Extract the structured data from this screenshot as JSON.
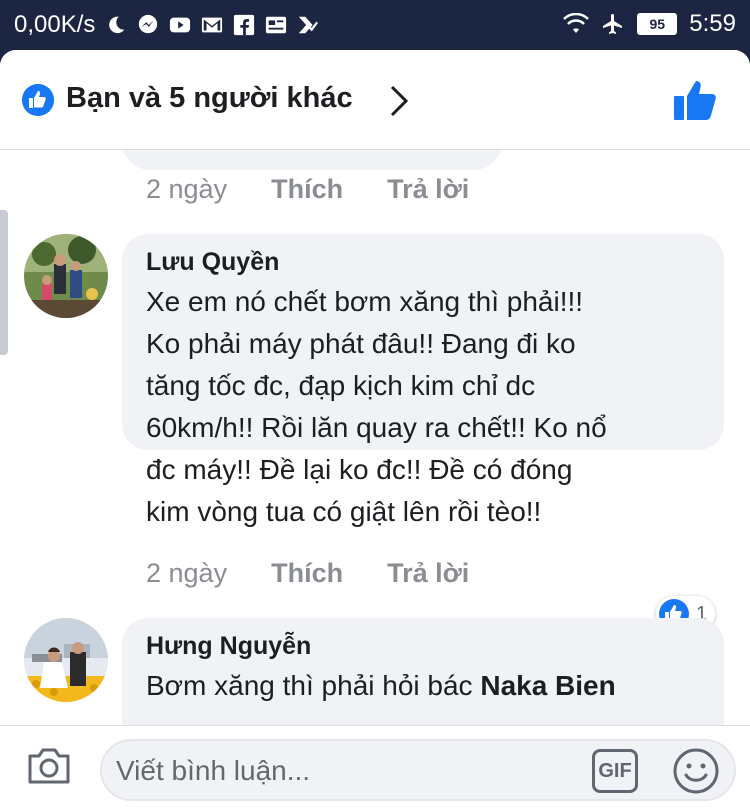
{
  "status_bar": {
    "net_speed": "0,00K/s",
    "battery": "95",
    "time": "5:59"
  },
  "header": {
    "likes_summary": "Bạn và 5 người khác"
  },
  "comments": [
    {
      "time": "2 ngày",
      "like_label": "Thích",
      "reply_label": "Trả lời"
    },
    {
      "author": "Lưu Quyền",
      "lines": [
        "Xe em nó chết bơm xăng thì phải!!!",
        "Ko phải máy phát đâu!! Đang đi ko",
        "tăng tốc đc, đạp kịch kim chỉ dc",
        "60km/h!! Rồi lăn quay ra chết!! Ko nổ",
        "đc máy!! Đề lại ko đc!! Đề có đóng",
        "kim vòng tua có giật lên rồi tèo!!"
      ],
      "time": "2 ngày",
      "like_label": "Thích",
      "reply_label": "Trả lời",
      "reaction_count": "1"
    },
    {
      "author": "Hưng Nguyễn",
      "text_prefix": "Bơm xăng thì phải hỏi bác ",
      "mention": "Naka Bien"
    }
  ],
  "composer": {
    "placeholder": "Viết bình luận...",
    "gif_label": "GIF"
  },
  "colors": {
    "accent": "#1877f2",
    "bubble": "#f0f2f5",
    "status_bar": "#1c2541"
  }
}
